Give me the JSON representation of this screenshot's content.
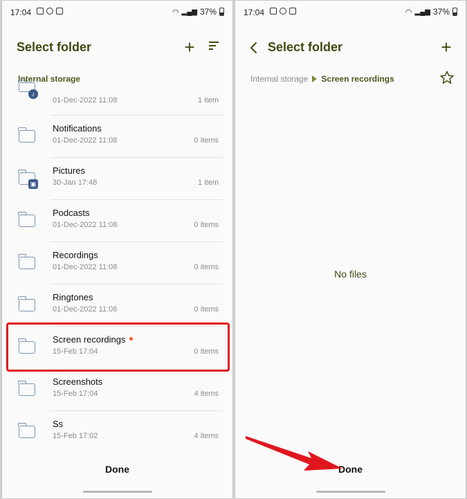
{
  "status": {
    "time": "17:04",
    "battery": "37%"
  },
  "left": {
    "title": "Select folder",
    "section": "Internal storage",
    "rows": [
      {
        "name": "",
        "date": "01-Dec-2022 11:08",
        "count": "1 item",
        "badge": "music-note"
      },
      {
        "name": "Notifications",
        "date": "01-Dec-2022 11:08",
        "count": "0 items"
      },
      {
        "name": "Pictures",
        "date": "30-Jan 17:48",
        "count": "1 item",
        "badge": "image"
      },
      {
        "name": "Podcasts",
        "date": "01-Dec-2022 11:08",
        "count": "0 items"
      },
      {
        "name": "Recordings",
        "date": "01-Dec-2022 11:08",
        "count": "0 items"
      },
      {
        "name": "Ringtones",
        "date": "01-Dec-2022 11:08",
        "count": "0 items"
      },
      {
        "name": "Screen recordings",
        "date": "15-Feb 17:04",
        "count": "0 items",
        "new": true
      },
      {
        "name": "Screenshots",
        "date": "15-Feb 17:04",
        "count": "4 items"
      },
      {
        "name": "Ss",
        "date": "15-Feb 17:02",
        "count": "4 items"
      }
    ],
    "done_label": "Done"
  },
  "right": {
    "title": "Select folder",
    "breadcrumb": [
      "Internal storage",
      "Screen recordings"
    ],
    "empty_text": "No files",
    "done_label": "Done"
  },
  "colors": {
    "accent": "#3e4a12",
    "highlight": "#e0161e",
    "folder": "#7d93b3"
  }
}
